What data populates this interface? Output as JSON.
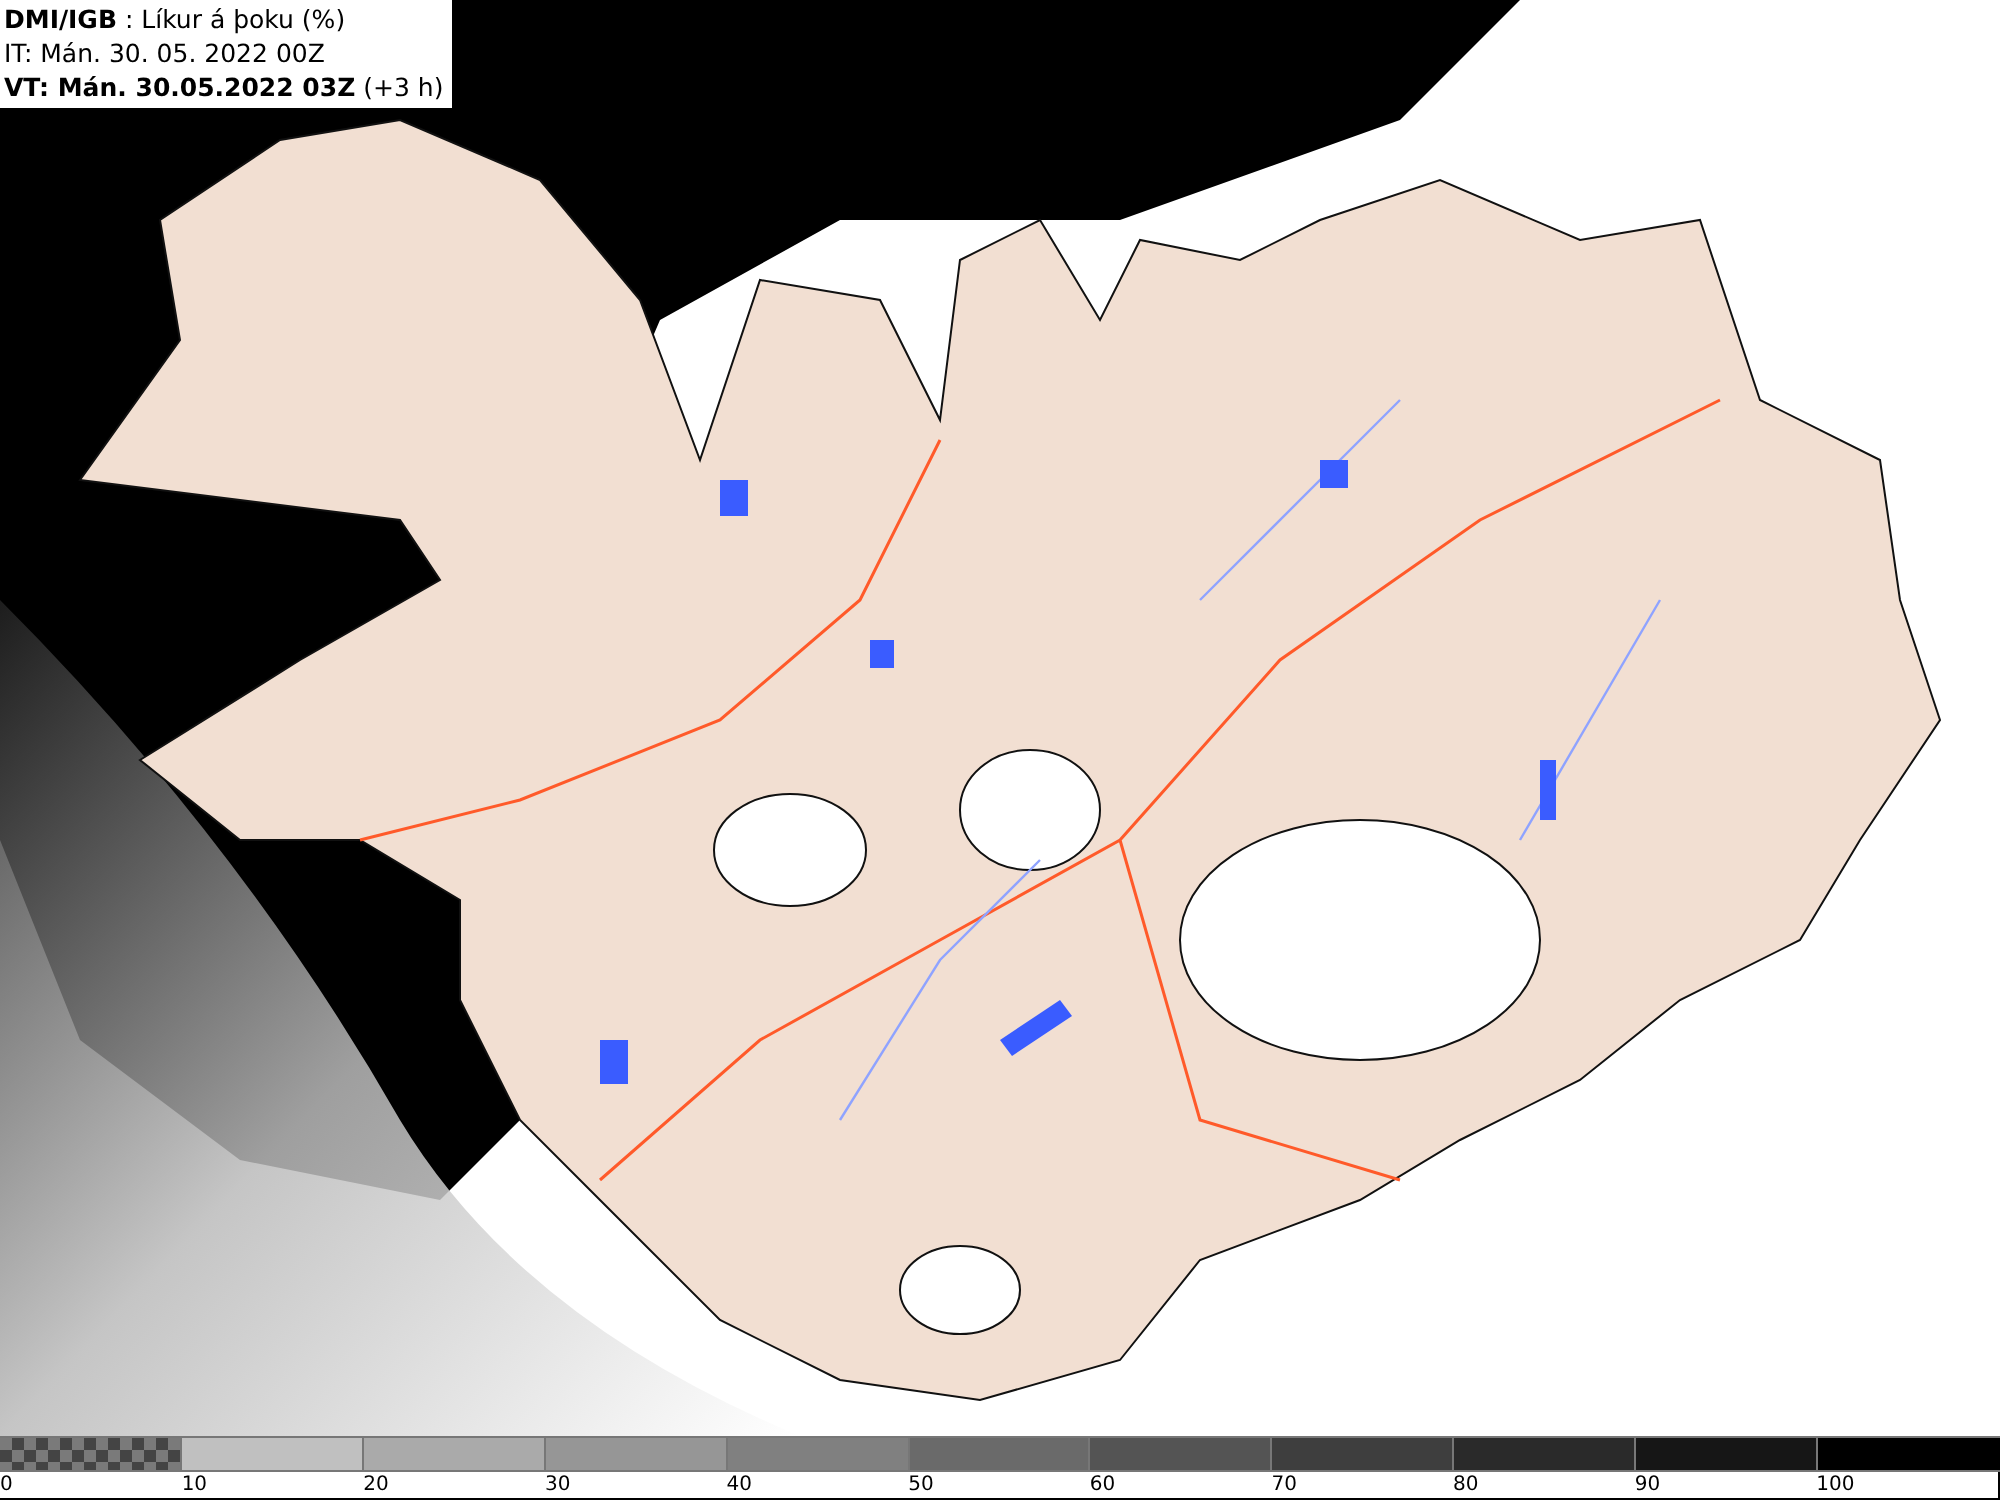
{
  "header": {
    "lines": [
      "**DMI/IGB** : Líkur á þoku (%)",
      "IT: Mán. 30. 05. 2022 00Z",
      "**VT: Mán. 30.05.2022 03Z** (+3 h)"
    ]
  },
  "legend": {
    "segments": [
      {
        "kind": "pattern",
        "color": "#7a7a7a"
      },
      {
        "kind": "solid",
        "color": "#c0c0c0"
      },
      {
        "kind": "solid",
        "color": "#aaaaaa"
      },
      {
        "kind": "solid",
        "color": "#969696"
      },
      {
        "kind": "solid",
        "color": "#808080"
      },
      {
        "kind": "solid",
        "color": "#6a6a6a"
      },
      {
        "kind": "solid",
        "color": "#545454"
      },
      {
        "kind": "solid",
        "color": "#3e3e3e"
      },
      {
        "kind": "solid",
        "color": "#2a2a2a"
      },
      {
        "kind": "solid",
        "color": "#161616"
      },
      {
        "kind": "solid",
        "color": "#000000"
      }
    ],
    "ticks": [
      "0",
      "10",
      "20",
      "30",
      "40",
      "50",
      "60",
      "70",
      "80",
      "90",
      "100"
    ]
  }
}
